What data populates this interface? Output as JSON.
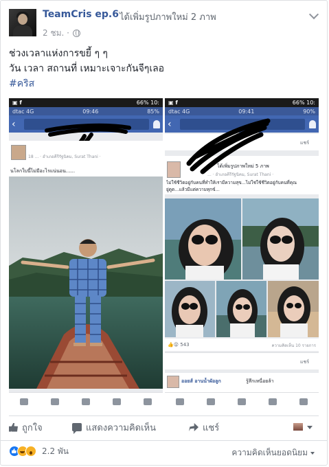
{
  "post": {
    "author": "TeamCris ep.6",
    "action": "ได้เพิ่มรูปภาพใหม่ 2 ภาพ",
    "time": "2 ชม. ·",
    "caption": [
      "ช่วงเวลาแห่งการขยี้ ๆ ๆ",
      "วัน เวลา สถานที่ เหมาะเจาะกันจีๆเลอ"
    ],
    "hashtag": "#คริส"
  },
  "screenshots": {
    "left": {
      "status_left": "dtac 4G",
      "status_time": "09:46",
      "status_right": "85%",
      "top_status": "66% 10:",
      "post_meta": "18 ... · อำเภอคีรีรัฐนิคม, Surat Thani ·",
      "post_text": "นโลกใบนี้ไม่มีอะไรแน่นอน......"
    },
    "right": {
      "status_left": "dtac 4G",
      "status_time": "09:41",
      "status_right": "90%",
      "top_status": "66% 10:",
      "share_label": "แชร์",
      "post_header": "ได้เพิ่มรูปภาพใหม่ 5 ภาพ",
      "post_meta": "... · อำเภอคีรีรัฐนิคม, Surat Thani ·",
      "post_text": "ไม่ใช้ชีวิตอยู่กับคนที่ทำให้เรามีความสุข...ไม่ใช่ใช้ชีวิตอยู่กับคนที่คุณ",
      "post_text2": "ยู่ดูด...แล้วมีแต่ความทุกข์...",
      "reaction_count": "543",
      "comment_count": "ความคิดเห็น 10 รายการ",
      "share_label2": "แชร์",
      "commenter": "ออยส์ อานน้ำผัอลูก",
      "comment_text": "รู้สึกเหนื่อยล้า"
    }
  },
  "actions": {
    "like": "ถูกใจ",
    "comment": "แสดงความคิดเห็น",
    "share": "แชร์"
  },
  "reactions": {
    "count": "2.2 พัน",
    "sort": "ความคิดเห็นยอดนิยม"
  }
}
